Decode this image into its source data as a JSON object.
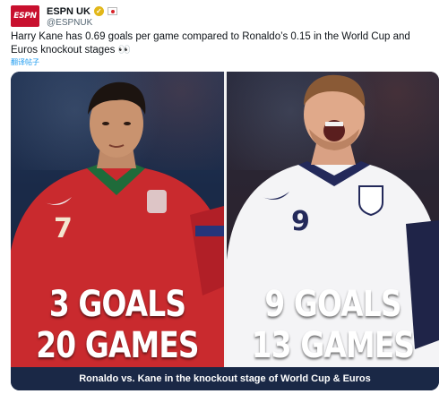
{
  "tweet": {
    "logo_text": "ESPN",
    "display_name": "ESPN UK",
    "verified_icon": "verified-badge-icon",
    "flag_icon": "england-flag-icon",
    "handle": "@ESPNUK",
    "text": "Harry Kane has 0.69 goals per game compared to Ronaldo’s 0.15 in the World Cup and Euros knockout stages 👀",
    "translate_label": "翻译帖子"
  },
  "media": {
    "left": {
      "player": "Ronaldo",
      "jersey_number": "7",
      "goals_line": "3 GOALS",
      "games_line": "20 GAMES"
    },
    "right": {
      "player": "Kane",
      "jersey_number": "9",
      "goals_line": "9 GOALS",
      "games_line": "13 GAMES"
    },
    "caption": "Ronaldo vs. Kane in the knockout stage of World Cup & Euros"
  },
  "colors": {
    "espn_red": "#c8102e",
    "link_blue": "#1d9bf0",
    "portugal_red": "#c92a2e",
    "england_white": "#f4f4f6",
    "caption_bg": "#1a2846"
  }
}
